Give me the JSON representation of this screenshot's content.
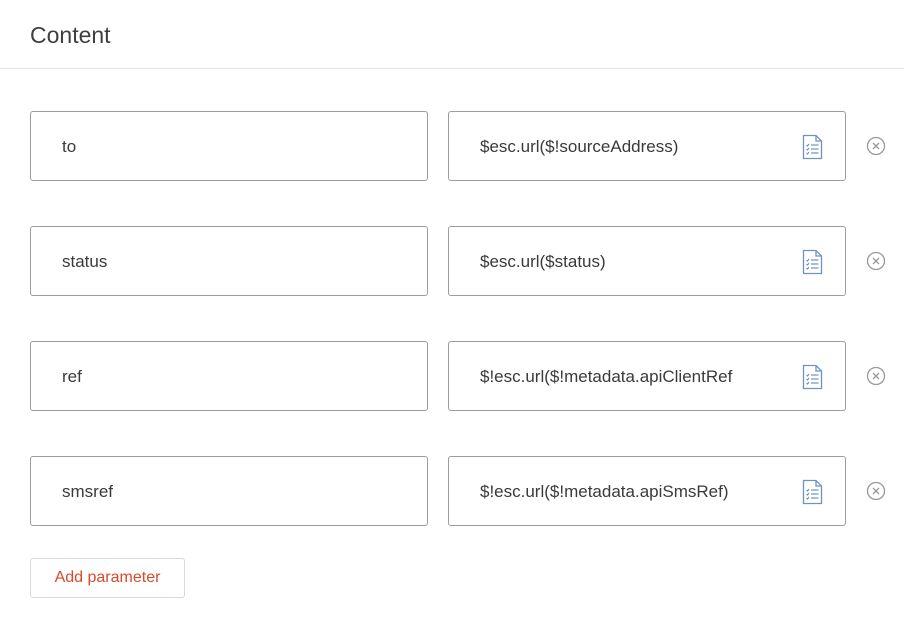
{
  "panel": {
    "title": "Content"
  },
  "parameters": [
    {
      "key": "to",
      "value": "$esc.url($!sourceAddress)"
    },
    {
      "key": "status",
      "value": "$esc.url($status)"
    },
    {
      "key": "ref",
      "value": "$!esc.url($!metadata.apiClientRef"
    },
    {
      "key": "smsref",
      "value": "$!esc.url($!metadata.apiSmsRef)"
    }
  ],
  "actions": {
    "add_parameter_label": "Add parameter"
  },
  "icons": {
    "value_field_icon": "document-list-icon",
    "remove_icon": "remove-circle-x-icon"
  },
  "colors": {
    "accent": "#d9492b",
    "icon": "#6f93bf",
    "border": "#9c9c9c"
  }
}
